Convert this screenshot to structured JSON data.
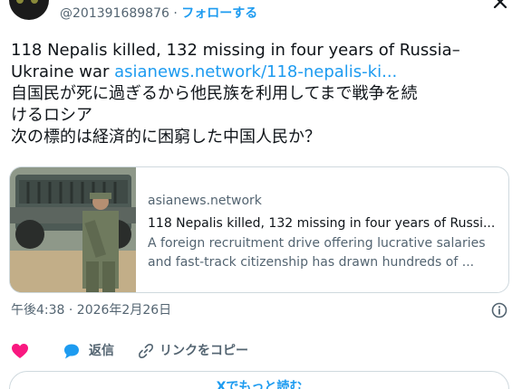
{
  "author": {
    "handle": "@201391689876",
    "separator": "·",
    "follow_label": "フォローする"
  },
  "tweet": {
    "line1": "118 Nepalis killed, 132 missing in four years of Russia–",
    "line2_text": "Ukraine war ",
    "line2_link": "asianews.network/118-nepalis-ki...",
    "line3": "自国民が死に過ぎるから他民族を利用してまで戦争を続",
    "line4": "けるロシア",
    "line5": "次の標的は経済的に困窮した中国人民か？"
  },
  "card": {
    "domain": "asianews.network",
    "title": "118 Nepalis killed, 132 missing in four years of Russi...",
    "description": "A foreign recruitment drive offering lucrative salaries and fast-track citizenship has drawn hundreds of ..."
  },
  "timestamp": "午後4:38 · 2026年2月26日",
  "actions": {
    "reply_label": "返信",
    "copy_link_label": "リンクをコピー"
  },
  "read_more_label": "Xでもっと読む",
  "colors": {
    "accent": "#1d9bf0",
    "heart": "#f91880",
    "secondary_text": "#536471",
    "border": "#cfd9de"
  },
  "icons": [
    "avatar",
    "close-icon",
    "info-icon",
    "heart-icon",
    "reply-icon",
    "link-icon"
  ]
}
